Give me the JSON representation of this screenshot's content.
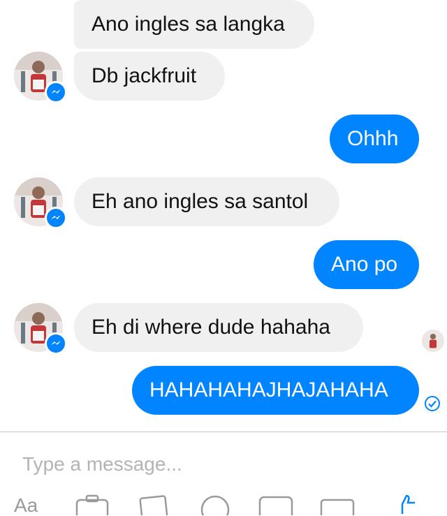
{
  "messages": [
    {
      "text": "Ano ingles sa langka",
      "from": "contact"
    },
    {
      "text": "Db jackfruit",
      "from": "contact"
    },
    {
      "text": "Ohhh",
      "from": "me"
    },
    {
      "text": "Eh ano ingles sa santol",
      "from": "contact"
    },
    {
      "text": "Ano po",
      "from": "me"
    },
    {
      "text": "Eh di where dude hahaha",
      "from": "contact"
    },
    {
      "text": "HAHAHAHAJHAJAHAHA",
      "from": "me"
    }
  ],
  "composer": {
    "placeholder": "Type a message..."
  },
  "toolbar": {
    "aa_label": "Aa",
    "icons": [
      "text-size-icon",
      "camera-icon",
      "photo-icon",
      "emoji-icon",
      "gif-icon",
      "more-icon",
      "like-icon"
    ]
  },
  "colors": {
    "outgoing": "#0084ff",
    "incoming": "#f0f0f0",
    "badge": "#0084ff"
  }
}
